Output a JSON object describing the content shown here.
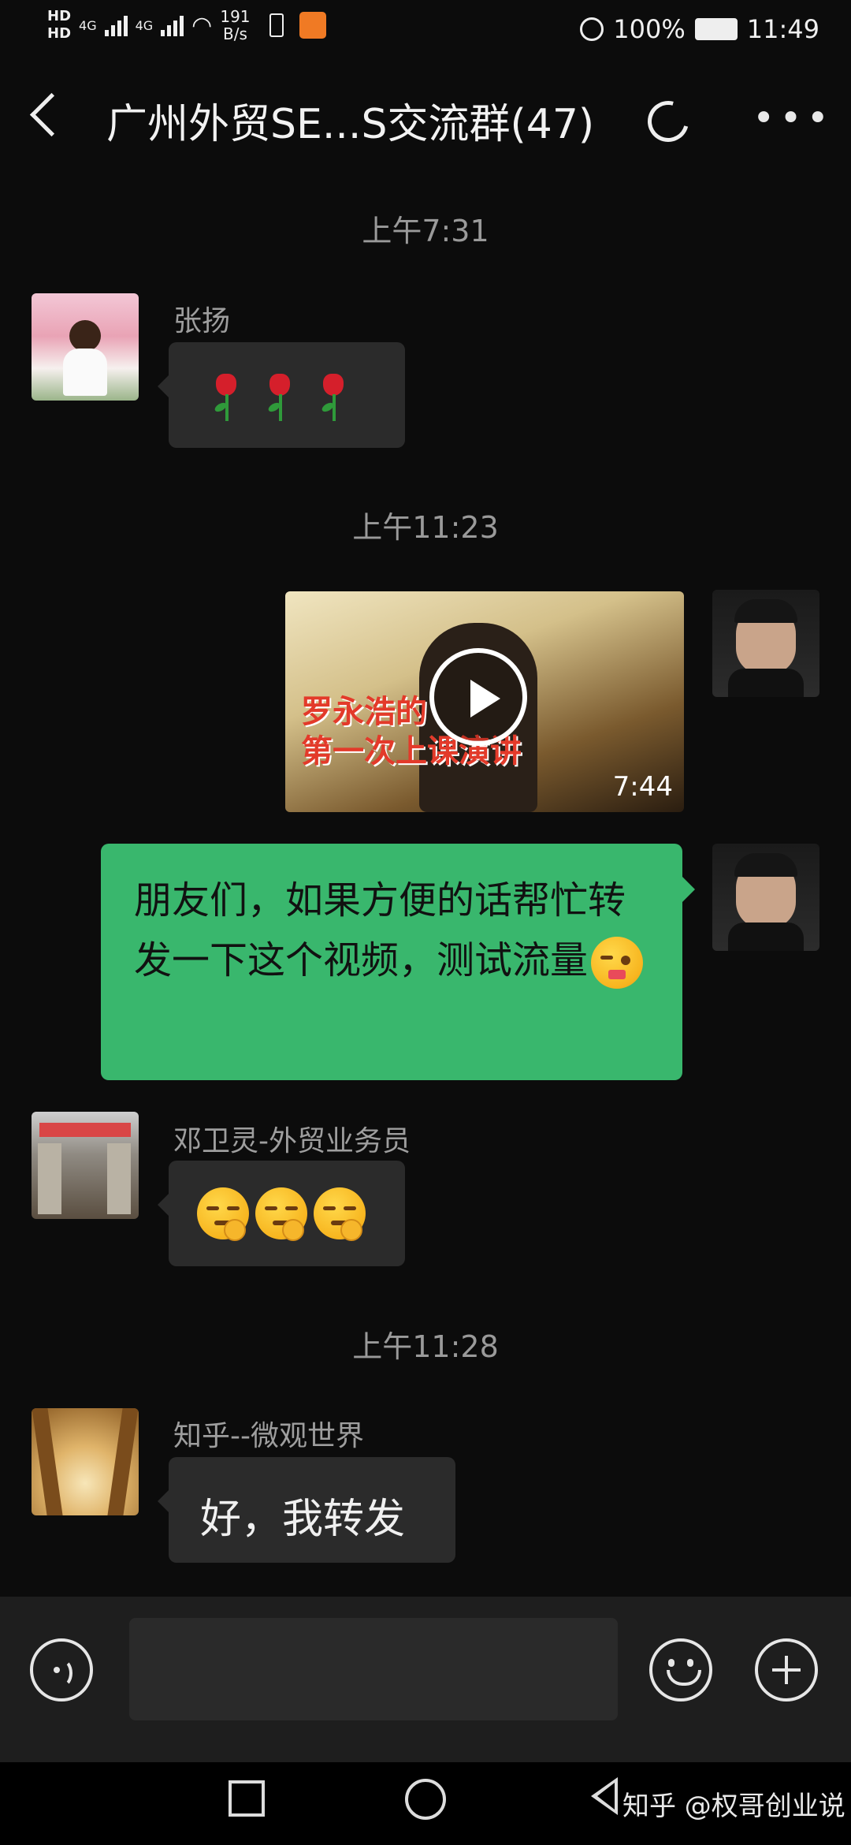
{
  "status_bar": {
    "hd1": "HD",
    "hd2": "HD",
    "net1": "4G",
    "net2": "4G",
    "speed_value": "191",
    "speed_unit": "B/s",
    "battery": "100%",
    "time": "11:49"
  },
  "header": {
    "title": "广州外贸SE...S交流群(47)"
  },
  "messages": [
    {
      "type": "time",
      "text": "上午7:31"
    },
    {
      "type": "incoming",
      "sender": "张扬",
      "content": "rose-emoji x3"
    },
    {
      "type": "time",
      "text": "上午11:23"
    },
    {
      "type": "outgoing-video",
      "caption_line1": "罗永浩的",
      "caption_line2": "第一次上课演讲",
      "duration": "7:44"
    },
    {
      "type": "outgoing-text",
      "text": "朋友们，如果方便的话帮忙转发一下这个视频，测试流量"
    },
    {
      "type": "incoming",
      "sender": "邓卫灵-外贸业务员",
      "content": "smirk-emoji x3"
    },
    {
      "type": "time",
      "text": "上午11:28"
    },
    {
      "type": "incoming",
      "sender": "知乎--微观世界",
      "text": "好，我转发"
    }
  ],
  "input_bar": {
    "icons": [
      "voice-icon",
      "emoji-icon",
      "plus-icon"
    ]
  },
  "watermark": "知乎 @权哥创业说",
  "colors": {
    "background": "#0c0c0c",
    "incoming_bubble": "#2b2b2b",
    "outgoing_bubble": "#39b76d"
  }
}
